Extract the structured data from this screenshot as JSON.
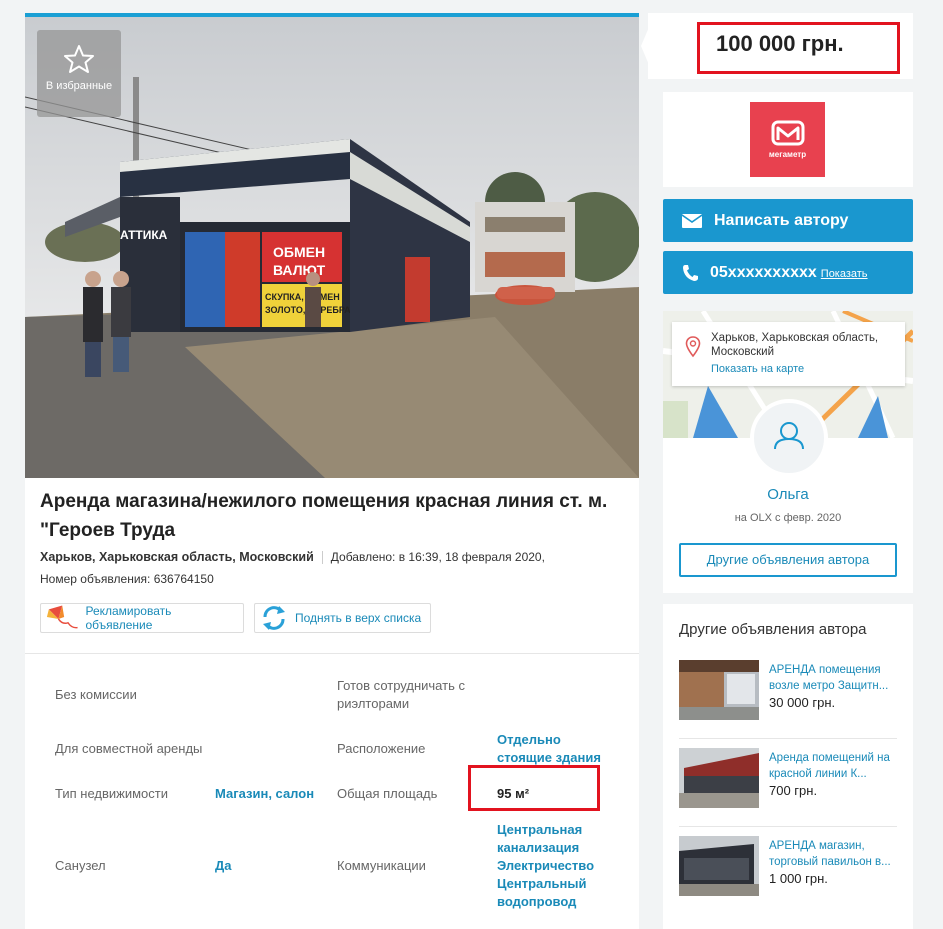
{
  "listing": {
    "favorite_label": "В избранные",
    "title": "Аренда магазина/нежилого помещения красная линия ст. м. \"Героев Труда",
    "location": "Харьков, Харьковская область, Московский",
    "added": "Добавлено: в 16:39, 18 февраля 2020,",
    "ad_number": "Номер объявления: 636764150",
    "promote_label": "Рекламировать объявление",
    "raise_label": "Поднять в верх списка",
    "photo_signs": {
      "attika": "АТТИКА",
      "exchange_1": "ОБМЕН",
      "exchange_2": "ВАЛЮТ",
      "buy_1": "СКУПКА, ОБМЕН",
      "buy_2": "ЗОЛОТО, СЕРЕБРА"
    }
  },
  "params": {
    "no_commission": "Без комиссии",
    "ready_realtors": "Готов сотрудничать с риэлторами",
    "joint_rent": "Для совместной аренды",
    "location_label": "Расположение",
    "location_value_1": "Отдельно",
    "location_value_2": "стоящие здания",
    "type_label": "Тип недвижимости",
    "type_value": "Магазин, салон",
    "area_label": "Общая площадь",
    "area_value": "95 м²",
    "bathroom_label": "Санузел",
    "bathroom_value": "Да",
    "comm_label": "Коммуникации",
    "comm_values": [
      "Центральная",
      "канализация",
      "Электричество",
      "Центральный",
      "водопровод"
    ]
  },
  "sidebar": {
    "price": "100 000 грн.",
    "logo_text": "мегаметр",
    "write_label": "Написать автору",
    "phone": "05xxxxxxxxxx",
    "show_phone": "Показать",
    "map_address_1": "Харьков, Харьковская область,",
    "map_address_2": "Московский",
    "show_on_map": "Показать на карте",
    "author_name": "Ольга",
    "author_since": "на OLX с февр. 2020",
    "other_ads_button": "Другие объявления автора",
    "other_ads_title": "Другие объявления автора",
    "other_ads": [
      {
        "title_1": "АРЕНДА помещения",
        "title_2": "возле метро Защитн...",
        "price": "30 000 грн."
      },
      {
        "title_1": "Аренда помещений на",
        "title_2": "красной линии К...",
        "price": "700 грн."
      },
      {
        "title_1": "АРЕНДА магазин,",
        "title_2": "торговый павильон в...",
        "price": "1 000 грн."
      }
    ]
  },
  "colors": {
    "accent": "#1a97cf",
    "link": "#1a8ab8",
    "highlight": "#e2131f",
    "logo": "#e8414f"
  }
}
